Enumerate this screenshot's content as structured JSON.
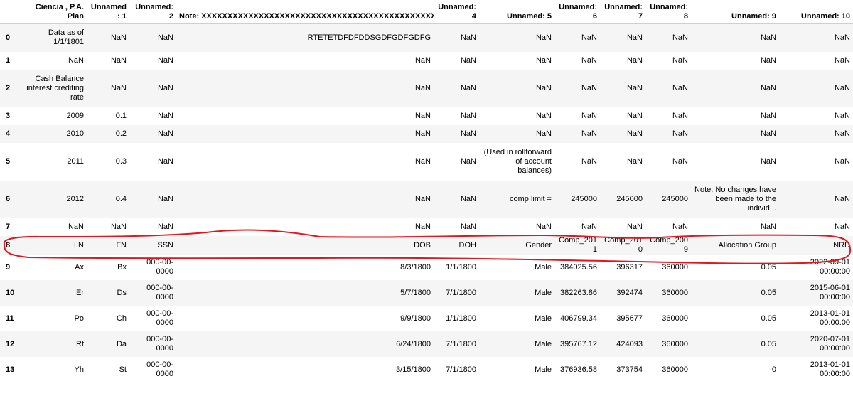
{
  "columns": [
    {
      "key": "idx",
      "label": ""
    },
    {
      "key": "c0",
      "label": "Ciencia , P.A. Plan"
    },
    {
      "key": "c1",
      "label": "Unnamed: 1"
    },
    {
      "key": "c2",
      "label": "Unnamed: 2"
    },
    {
      "key": "c3",
      "label": "Note: XXXXXXXXXXXXXXXXXXXXXXXXXXXXXXXXXXXXXXXXXXXXXXXXXXXXXX"
    },
    {
      "key": "c4",
      "label": "Unnamed: 4"
    },
    {
      "key": "c5",
      "label": "Unnamed: 5"
    },
    {
      "key": "c6",
      "label": "Unnamed: 6"
    },
    {
      "key": "c7",
      "label": "Unnamed: 7"
    },
    {
      "key": "c8",
      "label": "Unnamed: 8"
    },
    {
      "key": "c9",
      "label": "Unnamed: 9"
    },
    {
      "key": "c10",
      "label": "Unnamed: 10"
    }
  ],
  "rows": [
    {
      "index": "0",
      "cells": [
        "Data as of 1/1/1801",
        "NaN",
        "NaN",
        "RTETETDFDFDDSGDFGDFGDFG",
        "NaN",
        "NaN",
        "NaN",
        "NaN",
        "NaN",
        "NaN",
        "NaN"
      ]
    },
    {
      "index": "1",
      "cells": [
        "NaN",
        "NaN",
        "NaN",
        "NaN",
        "NaN",
        "NaN",
        "NaN",
        "NaN",
        "NaN",
        "NaN",
        "NaN"
      ]
    },
    {
      "index": "2",
      "cells": [
        "Cash Balance interest crediting rate",
        "NaN",
        "NaN",
        "NaN",
        "NaN",
        "NaN",
        "NaN",
        "NaN",
        "NaN",
        "NaN",
        "NaN"
      ]
    },
    {
      "index": "3",
      "cells": [
        "2009",
        "0.1",
        "NaN",
        "NaN",
        "NaN",
        "NaN",
        "NaN",
        "NaN",
        "NaN",
        "NaN",
        "NaN"
      ]
    },
    {
      "index": "4",
      "cells": [
        "2010",
        "0.2",
        "NaN",
        "NaN",
        "NaN",
        "NaN",
        "NaN",
        "NaN",
        "NaN",
        "NaN",
        "NaN"
      ]
    },
    {
      "index": "5",
      "cells": [
        "2011",
        "0.3",
        "NaN",
        "NaN",
        "NaN",
        "(Used in rollforward of account balances)",
        "NaN",
        "NaN",
        "NaN",
        "NaN",
        "NaN"
      ]
    },
    {
      "index": "6",
      "cells": [
        "2012",
        "0.4",
        "NaN",
        "NaN",
        "NaN",
        "comp limit =",
        "245000",
        "245000",
        "245000",
        "Note: No changes have been made to the individ...",
        "NaN"
      ]
    },
    {
      "index": "7",
      "cells": [
        "NaN",
        "NaN",
        "NaN",
        "NaN",
        "NaN",
        "NaN",
        "NaN",
        "NaN",
        "NaN",
        "NaN",
        "NaN"
      ]
    },
    {
      "index": "8",
      "cells": [
        "LN",
        "FN",
        "SSN",
        "DOB",
        "DOH",
        "Gender",
        "Comp_2011",
        "Comp_2010",
        "Comp_2009",
        "Allocation Group",
        "NRD"
      ]
    },
    {
      "index": "9",
      "cells": [
        "Ax",
        "Bx",
        "000-00-0000",
        "8/3/1800",
        "1/1/1800",
        "Male",
        "384025.56",
        "396317",
        "360000",
        "0.05",
        "2022-09-01 00:00:00"
      ]
    },
    {
      "index": "10",
      "cells": [
        "Er",
        "Ds",
        "000-00-0000",
        "5/7/1800",
        "7/1/1800",
        "Male",
        "382263.86",
        "392474",
        "360000",
        "0.05",
        "2015-06-01 00:00:00"
      ]
    },
    {
      "index": "11",
      "cells": [
        "Po",
        "Ch",
        "000-00-0000",
        "9/9/1800",
        "1/1/1800",
        "Male",
        "406799.34",
        "395677",
        "360000",
        "0.05",
        "2013-01-01 00:00:00"
      ]
    },
    {
      "index": "12",
      "cells": [
        "Rt",
        "Da",
        "000-00-0000",
        "6/24/1800",
        "7/1/1800",
        "Male",
        "395767.12",
        "424093",
        "360000",
        "0.05",
        "2020-07-01 00:00:00"
      ]
    },
    {
      "index": "13",
      "cells": [
        "Yh",
        "St",
        "000-00-0000",
        "3/15/1800",
        "7/1/1800",
        "Male",
        "376936.58",
        "373754",
        "360000",
        "0",
        "2013-01-01 00:00:00"
      ]
    }
  ],
  "annotation": {
    "color": "#e8141b",
    "highlighted_row": "8"
  }
}
